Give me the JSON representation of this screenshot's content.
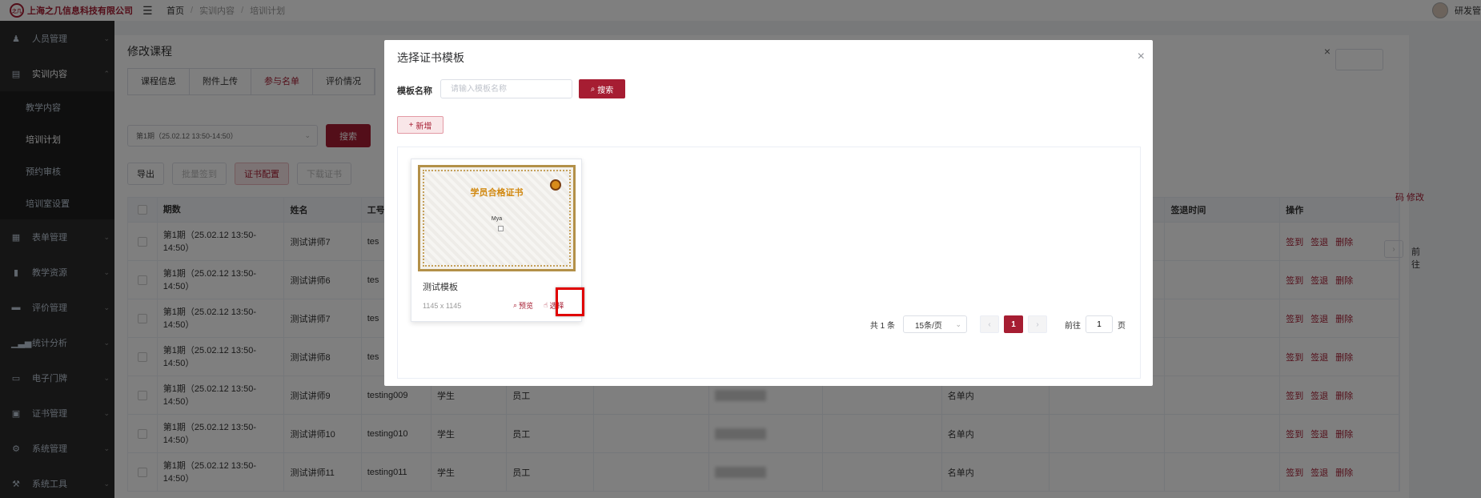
{
  "header": {
    "company": "上海之几信息科技有限公司",
    "logo_text": "之几",
    "breadcrumb": [
      "首页",
      "实训内容",
      "培训计划"
    ],
    "user": "研发管"
  },
  "sidebar": {
    "items": [
      {
        "label": "人员管理",
        "icon": "user-icon"
      },
      {
        "label": "实训内容",
        "icon": "folder-icon"
      },
      {
        "label": "教学内容",
        "sub": true
      },
      {
        "label": "培训计划",
        "sub": true
      },
      {
        "label": "预约审核",
        "sub": true
      },
      {
        "label": "培训室设置",
        "sub": true
      },
      {
        "label": "表单管理",
        "icon": "form-icon"
      },
      {
        "label": "教学资源",
        "icon": "book-icon"
      },
      {
        "label": "评价管理",
        "icon": "comment-icon"
      },
      {
        "label": "统计分析",
        "icon": "chart-icon"
      },
      {
        "label": "电子门牌",
        "icon": "monitor-icon"
      },
      {
        "label": "证书管理",
        "icon": "certificate-icon"
      },
      {
        "label": "系统管理",
        "icon": "gear-icon"
      },
      {
        "label": "系统工具",
        "icon": "tool-icon"
      }
    ]
  },
  "page": {
    "title": "修改课程",
    "tabs": [
      "课程信息",
      "附件上传",
      "参与名单",
      "评价情况"
    ],
    "period_select": "第1期（25.02.12 13:50-14:50）",
    "search_label": "搜索",
    "actions": {
      "export": "导出",
      "batch_sign": "批量签到",
      "cert_config": "证书配置",
      "download_cert": "下载证书"
    },
    "table": {
      "headers": {
        "period": "期数",
        "name": "姓名",
        "job": "工号",
        "sign_out_time": "签退时间",
        "ops": "操作"
      },
      "op_labels": {
        "sign_in": "签到",
        "sign_out": "签退",
        "delete": "删除"
      },
      "rows": [
        {
          "period": "第1期（25.02.12 13:50-14:50）",
          "name": "测试讲师7",
          "job": "tes",
          "type": "",
          "dept": "",
          "status": ""
        },
        {
          "period": "第1期（25.02.12 13:50-14:50）",
          "name": "测试讲师6",
          "job": "tes",
          "type": "",
          "dept": "",
          "status": ""
        },
        {
          "period": "第1期（25.02.12 13:50-14:50）",
          "name": "测试讲师7",
          "job": "tes",
          "type": "",
          "dept": "",
          "status": ""
        },
        {
          "period": "第1期（25.02.12 13:50-14:50）",
          "name": "测试讲师8",
          "job": "tes",
          "type": "",
          "dept": "",
          "status": ""
        },
        {
          "period": "第1期（25.02.12 13:50-14:50）",
          "name": "测试讲师9",
          "job": "testing009",
          "type": "学生",
          "dept": "员工",
          "status": "名单内"
        },
        {
          "period": "第1期（25.02.12 13:50-14:50）",
          "name": "测试讲师10",
          "job": "testing010",
          "type": "学生",
          "dept": "员工",
          "status": "名单内"
        },
        {
          "period": "第1期（25.02.12 13:50-14:50）",
          "name": "测试讲师11",
          "job": "testing011",
          "type": "学生",
          "dept": "员工",
          "status": "名单内"
        }
      ]
    },
    "right_links": "码  修改",
    "right_pager": "前往"
  },
  "dialog": {
    "title": "选择证书模板",
    "close": "×",
    "field_label": "模板名称",
    "field_placeholder": "请输入模板名称",
    "search_label": "搜索",
    "add_label": "新增",
    "card": {
      "cert_title": "学员合格证书",
      "cert_name": "Mya",
      "name": "测试模板",
      "size": "1145 x 1145",
      "preview": "预览",
      "select": "选择"
    },
    "pager": {
      "total": "共 1 条",
      "page_size": "15条/页",
      "current": "1",
      "goto": "前往",
      "goto_value": "1",
      "page_unit": "页"
    }
  },
  "colors": {
    "primary": "#a61d32",
    "highlight": "#e00000",
    "sidebar": "#2b2b2b"
  }
}
